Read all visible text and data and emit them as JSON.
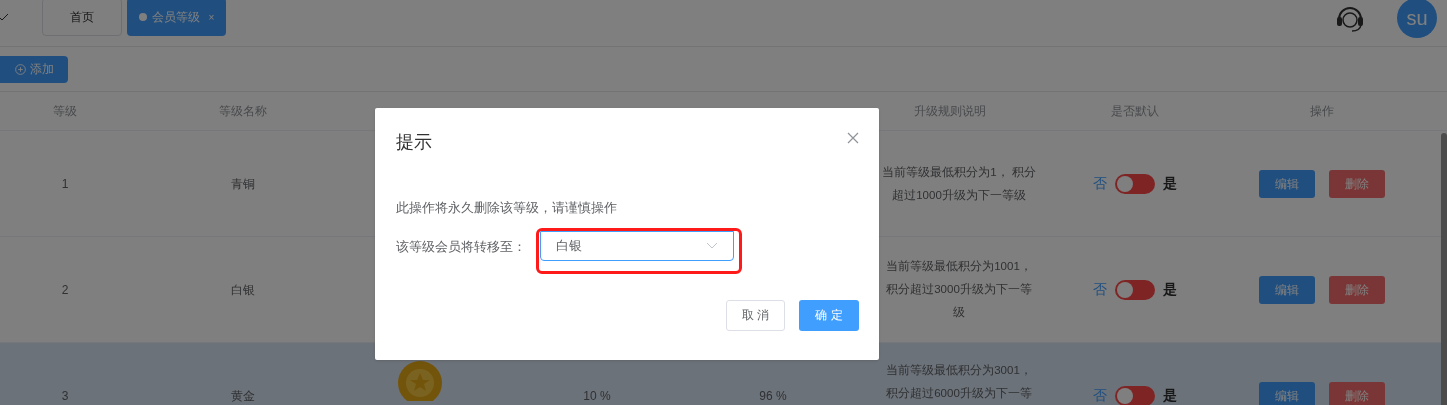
{
  "tabs": [
    {
      "label": "首页",
      "selected": false,
      "closable": false
    },
    {
      "label": "会员等级",
      "selected": true,
      "closable": true,
      "close": "×"
    }
  ],
  "user": {
    "initials": "su"
  },
  "toolbar": {
    "add_button": "添加"
  },
  "table": {
    "columns": [
      "等级",
      "等级名称",
      "升级规则说明",
      "是否默认",
      "操作"
    ],
    "rows": [
      {
        "level": "1",
        "name": "青铜",
        "rule": "当前等级最低积分为1， 积分超过1000升级为下一等级",
        "default_no": "否",
        "default_yes": "是",
        "is_default": false,
        "hovered": false,
        "edit": "编辑",
        "delete": "删除"
      },
      {
        "level": "2",
        "name": "白银",
        "rule": "当前等级最低积分为1001，积分超过3000升级为下一等级",
        "default_no": "否",
        "default_yes": "是",
        "is_default": false,
        "hovered": false,
        "edit": "编辑",
        "delete": "删除"
      },
      {
        "level": "3",
        "name": "黄金",
        "commission": "10 %",
        "discount": "96 %",
        "rule": "当前等级最低积分为3001，积分超过6000升级为下一等",
        "default_no": "否",
        "default_yes": "是",
        "is_default": false,
        "hovered": true,
        "show_medal": true,
        "edit": "编辑",
        "delete": "删除"
      }
    ]
  },
  "dialog": {
    "title": "提示",
    "message": "此操作将永久删除该等级，请谨慎操作",
    "field_label": "该等级会员将转移至：",
    "select_value": "白银",
    "highlighted": true,
    "cancel": "取 消",
    "confirm": "确 定"
  }
}
